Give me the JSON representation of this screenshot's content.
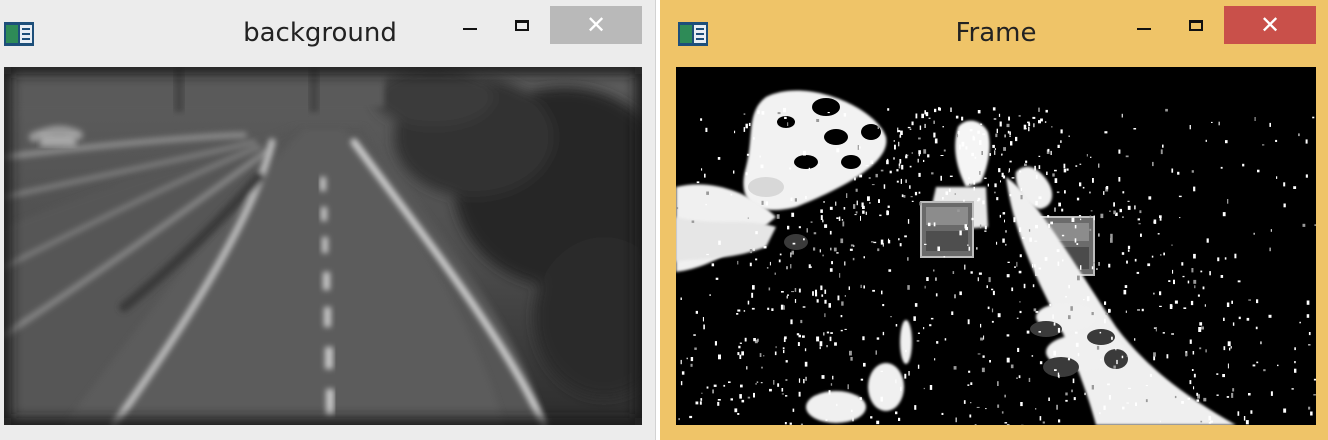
{
  "windows": {
    "background": {
      "title": "background",
      "close_color": "#b9b9b9",
      "frame_color": "#ececec"
    },
    "frame": {
      "title": "Frame",
      "close_color": "#c9504a",
      "frame_color": "#efc468"
    }
  },
  "controls": {
    "minimize_icon": "minimize-icon",
    "maximize_icon": "maximize-icon",
    "close_glyph": "✕"
  }
}
